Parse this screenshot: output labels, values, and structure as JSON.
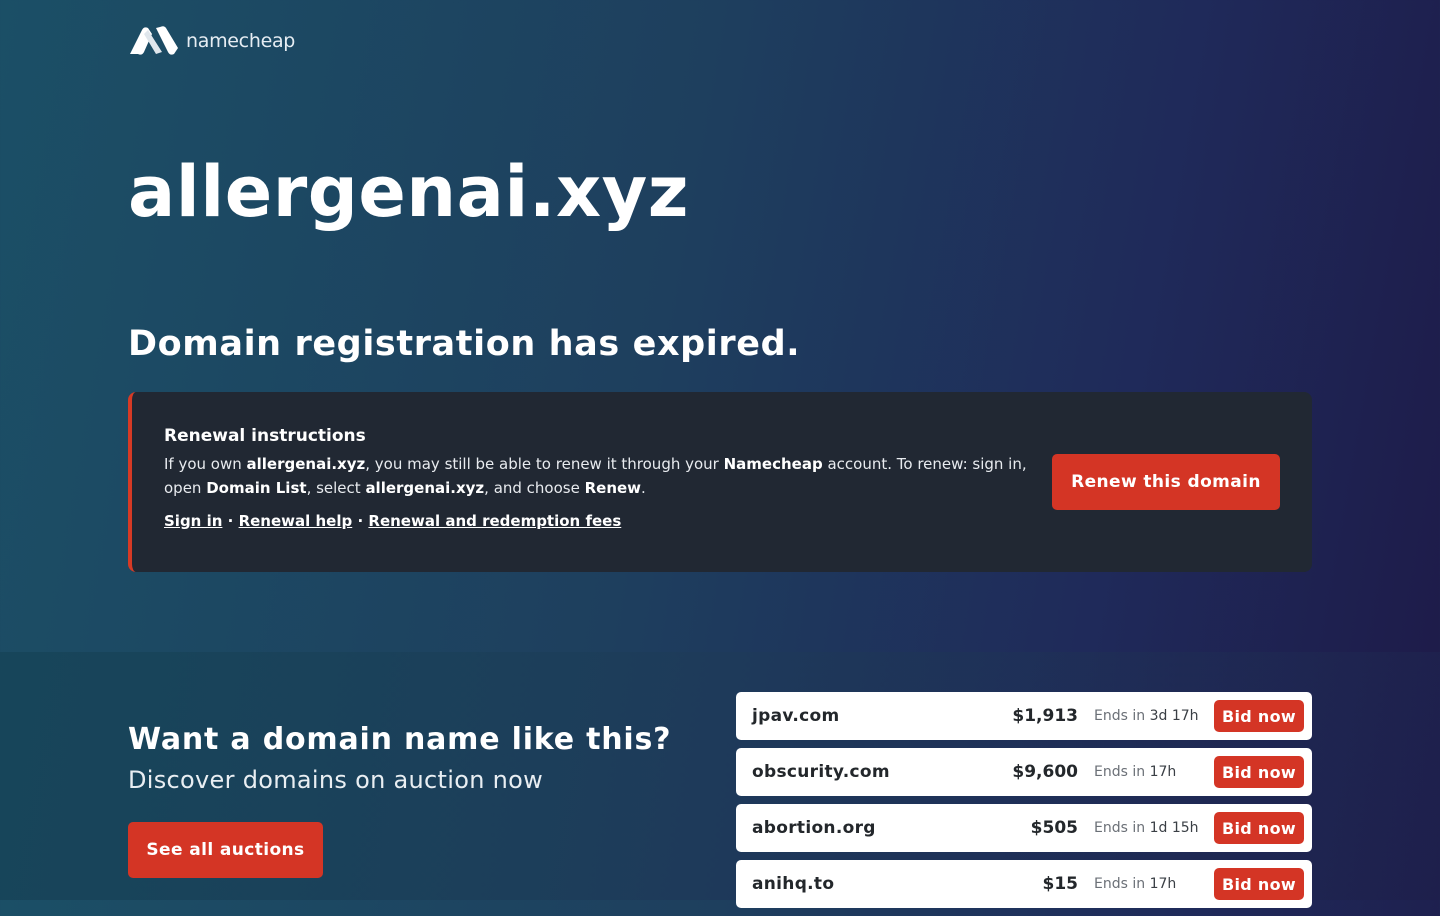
{
  "brand": {
    "name": "namecheap"
  },
  "domain": "allergenai.xyz",
  "status_heading": "Domain registration has expired.",
  "renewal": {
    "heading": "Renewal instructions",
    "text_parts": {
      "p1": "If you own ",
      "domain": "allergenai.xyz",
      "p2": ", you may still be able to renew it through your ",
      "registrar": "Namecheap",
      "p3": " account. To renew: sign in, open ",
      "list": "Domain List",
      "p4": ", select ",
      "domain2": "allergenai.xyz",
      "p5": ", and choose ",
      "action": "Renew",
      "p6": "."
    },
    "links": {
      "sign_in": "Sign in",
      "help": "Renewal help",
      "fees": "Renewal and redemption fees",
      "separator": "·"
    },
    "button": "Renew this domain"
  },
  "promo": {
    "heading": "Want a domain name like this?",
    "subheading": "Discover domains on auction now",
    "button": "See all auctions"
  },
  "auctions": [
    {
      "name": "jpav.com",
      "price": "$1,913",
      "ends_label": "Ends in",
      "ends": "3d 17h",
      "button": "Bid now"
    },
    {
      "name": "obscurity.com",
      "price": "$9,600",
      "ends_label": "Ends in",
      "ends": "17h",
      "button": "Bid now"
    },
    {
      "name": "abortion.org",
      "price": "$505",
      "ends_label": "Ends in",
      "ends": "1d 15h",
      "button": "Bid now"
    },
    {
      "name": "anihq.to",
      "price": "$15",
      "ends_label": "Ends in",
      "ends": "17h",
      "button": "Bid now"
    }
  ],
  "colors": {
    "accent": "#d43525",
    "card_bg": "#212833"
  }
}
